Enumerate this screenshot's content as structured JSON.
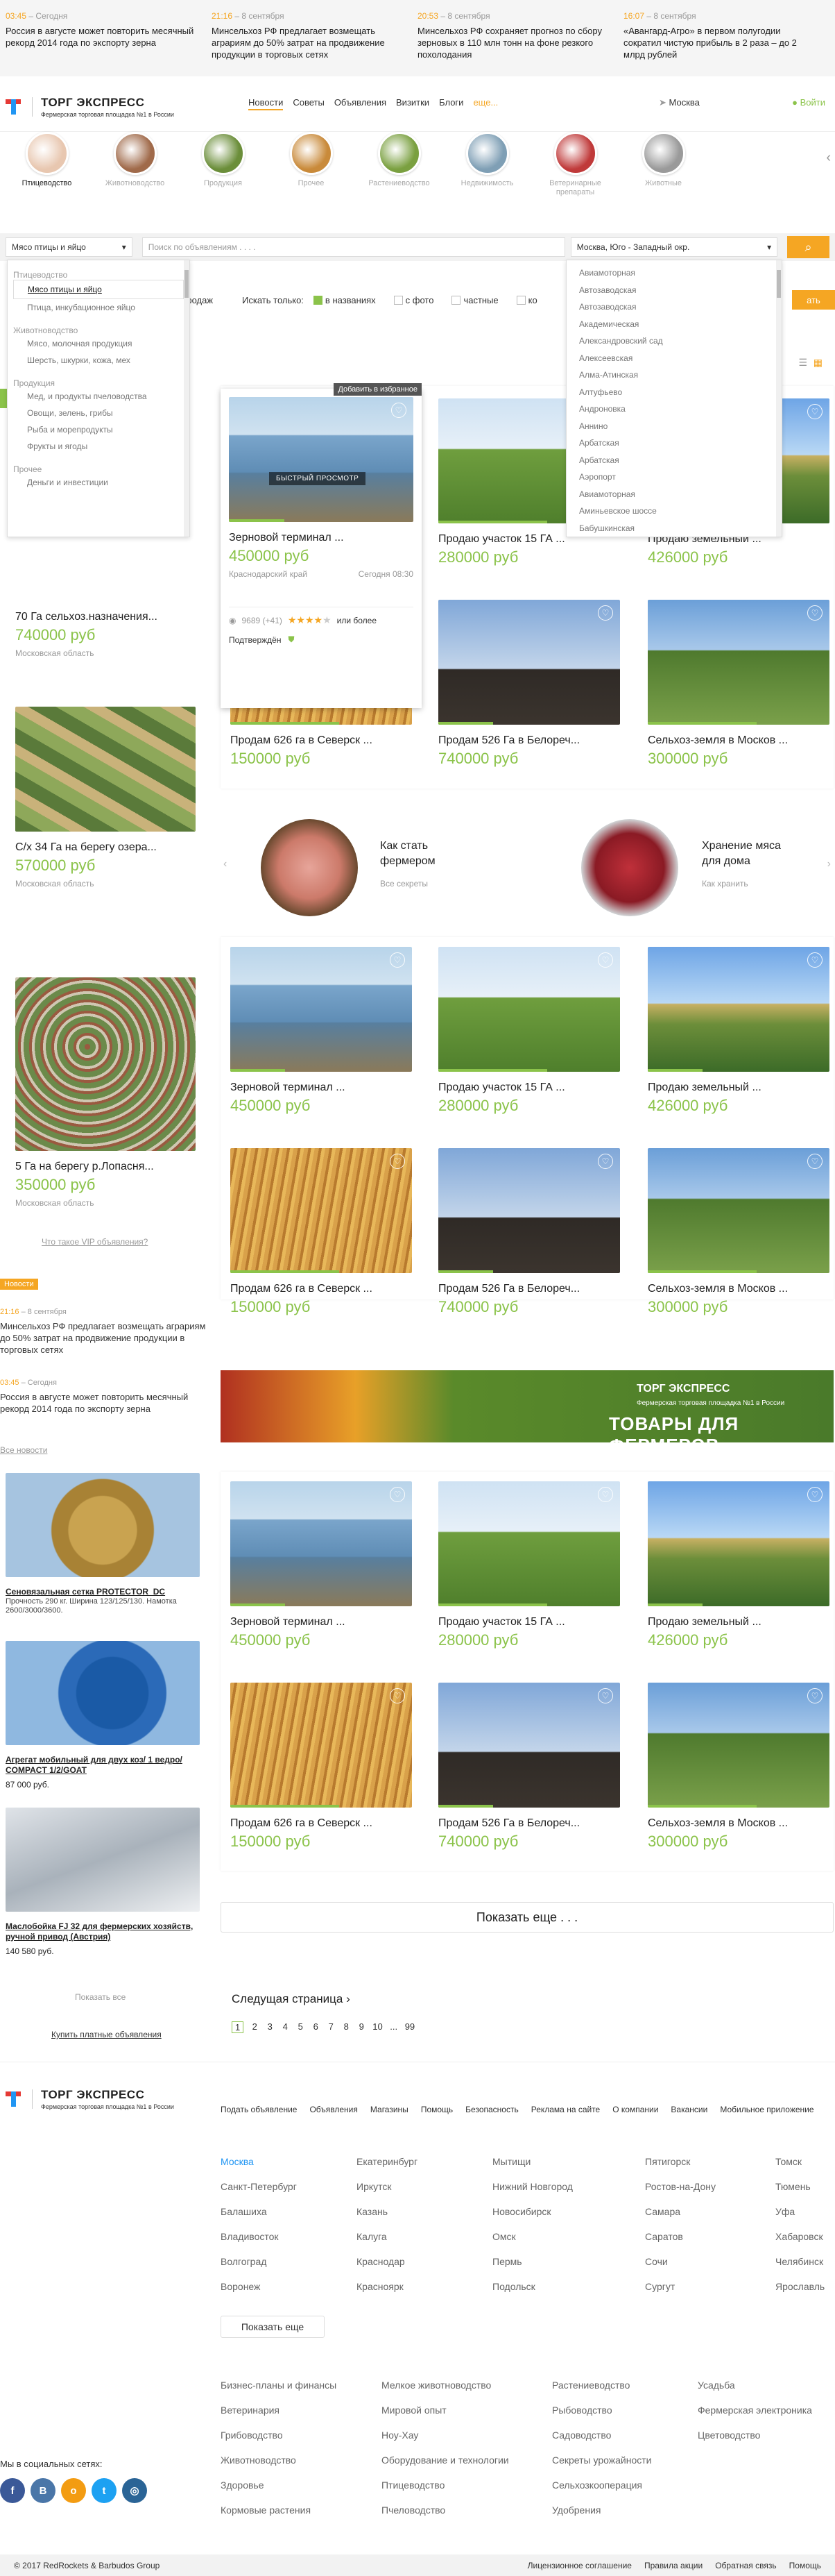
{
  "news_strip": [
    {
      "time": "03:45",
      "date": "Сегодня",
      "text": "Россия в августе может повторить ме­сячный рекорд 2014 года по экспорту зерна"
    },
    {
      "time": "21:16",
      "date": "8 сентября",
      "text": "Минсельхоз РФ предлагает возмещать аграриям до 50% затрат на продвижение продукции в торговых сетях"
    },
    {
      "time": "20:53",
      "date": "8 сентября",
      "text": "Минсельхоз РФ сохраняет прогноз по сбору зерновых в 110 млн тонн на фоне резкого похолодания"
    },
    {
      "time": "16:07",
      "date": "8 сентября",
      "text": "«Авангард-Агро» в первом полугодии сократил чистую прибыль в 2 раза – до 2 млрд рублей"
    }
  ],
  "header": {
    "logo_title": "ТОРГ ЭКСПРЕСС",
    "logo_sub": "Фермерская торговая площадка №1 в России",
    "nav": [
      "Новости",
      "Советы",
      "Объявления",
      "Визитки",
      "Блоги"
    ],
    "nav_more": "еще...",
    "city": "Москва",
    "login": "Войти"
  },
  "categories": [
    {
      "label": "Птицеводство",
      "color": "#e8c7b0"
    },
    {
      "label": "Животновод­ство",
      "color": "#a06a4a"
    },
    {
      "label": "Продукция",
      "color": "#6b8e3a"
    },
    {
      "label": "Прочее",
      "color": "#c98a3a"
    },
    {
      "label": "Растениевод­ство",
      "color": "#7aa040"
    },
    {
      "label": "Недвижимость",
      "color": "#7f9fb5"
    },
    {
      "label": "Ветеринарные препараты",
      "color": "#c03a3a"
    },
    {
      "label": "Животные",
      "color": "#9a9a9a"
    }
  ],
  "search": {
    "category": "Мясо птицы и яйцо",
    "placeholder": "Поиск по объявлениям . . . .",
    "region": "Москва, Юго - Западный окр."
  },
  "filter": {
    "trade_label": "Продаж",
    "only_label": "Искать только:",
    "options": [
      "в названиях",
      "с фото",
      "частные",
      "ко"
    ],
    "show": "ать"
  },
  "cat_dropdown": [
    {
      "group": "Птицеводство",
      "items": [
        "Мясо птицы и яйцо",
        "Птица, инкубационное яйцо"
      ]
    },
    {
      "group": "Животноводство",
      "items": [
        "Мясо, молочная продукция",
        "Шерсть, шкурки, кожа, мех"
      ]
    },
    {
      "group": "Продукция",
      "items": [
        "Мед, и продукты пчеловодства",
        "Овощи, зелень, грибы",
        "Рыба и морепродукты",
        "Фрукты и ягоды"
      ]
    },
    {
      "group": "Прочее",
      "items": [
        "Деньги и инвестиции"
      ]
    }
  ],
  "city_dropdown": [
    "Авиамоторная",
    "Автозаводская",
    "Автозаводская",
    "Академическая",
    "Александровский сад",
    "Алексеевская",
    "Алма-Атинская",
    "Алтуфьево",
    "Андроновка",
    "Аннино",
    "Арбатская",
    "Арбатская",
    "Аэропорт",
    "Авиамоторная",
    "Аминьевское шоссе",
    "Бабушкинская"
  ],
  "vip": [
    {
      "title": "70 Га сельхоз.назначения...",
      "price": "740000 руб",
      "region": "Московская область"
    },
    {
      "title": "С/х 34 Га на берегу озера...",
      "price": "570000 руб",
      "region": "Московская область"
    },
    {
      "title": "5 Га на берегу р.Лопасня...",
      "price": "350000 руб",
      "region": "Московская область"
    }
  ],
  "vip_link": "Что такое VIP объявления?",
  "featured": {
    "fav": "Добавить в избранное",
    "quick": "БЫСТРЫЙ ПРОСМОТР",
    "title": "Зерновой терминал ...",
    "price": "450000 руб",
    "region": "Краснодарский край",
    "time": "Сегодня 08:30",
    "views": "9689 (+41)",
    "rating": "или более",
    "status": "Подтверждён"
  },
  "grid": [
    {
      "title": "Зерновой терминал ...",
      "price": "450000 руб",
      "type": "img-grain"
    },
    {
      "title": "Продаю участок 15 ГА ...",
      "price": "280000 руб",
      "type": "img-field"
    },
    {
      "title": "Продаю земельный ...",
      "price": "426000 руб",
      "type": "img-land"
    },
    {
      "title": "Продам 626 га в Северск ...",
      "price": "150000 руб",
      "type": "img-wheat"
    },
    {
      "title": "Продам 526 Га в Белореч...",
      "price": "740000 руб",
      "type": "img-dark"
    },
    {
      "title": "Сельхоз-земля в Москов ...",
      "price": "300000 руб",
      "type": "img-green"
    }
  ],
  "promo": [
    {
      "title": "Как стать фермером",
      "sub": "Все секреты"
    },
    {
      "title": "Хранение мяса для дома",
      "sub": "Как хранить"
    }
  ],
  "news_side": {
    "badge": "Новости",
    "items": [
      {
        "time": "21:16",
        "date": "8 сентября",
        "text": "Минсельхоз РФ предлагает возмещать аграриям до 50% затрат на продвиже­ние продукции в торговых сетях"
      },
      {
        "time": "03:45",
        "date": "Сегодня",
        "text": "Россия в августе может повторить месячный рекорд 2014 года по экспорту зерна"
      }
    ],
    "all": "Все новости"
  },
  "banner": {
    "title": "ТОРГ ЭКСПРЕСС",
    "sub": "Фермерская торговая площадка №1 в России",
    "slogan": "ТОВАРЫ ДЛЯ ФЕРМЕРОВ"
  },
  "ads": [
    {
      "title": "Сеновязальная сетка PROTECTOR_DC",
      "text": "Прочность 290 кг. Ширина 123/125/130. Намотка 2600/3000/3600.",
      "price": ""
    },
    {
      "title": "Агрегат мобильный для двух коз/ 1 ведро/ COMPACT 1/2/GOAT",
      "text": "",
      "price": "87 000 руб."
    },
    {
      "title": "Маслобойка FJ 32 для фермерских хозяйств, ручной привод (Австрия)",
      "text": "",
      "price": "140 580 руб."
    }
  ],
  "ads_all": "Показать все",
  "ads_buy": "Купить платные объявления",
  "more": "Показать еще . . .",
  "next_page": "Следущая страница",
  "pages": [
    "1",
    "2",
    "3",
    "4",
    "5",
    "6",
    "7",
    "8",
    "9",
    "10",
    "...",
    "99"
  ],
  "footer": {
    "nav": [
      "Подать объявление",
      "Объявления",
      "Магазины",
      "Помощь",
      "Безопасность",
      "Реклама на сайте",
      "О компании",
      "Вакансии",
      "Мобильное приложение"
    ],
    "cities": [
      [
        "Москва",
        "Санкт-Петербург",
        "Балашиха",
        "Владивосток",
        "Волгоград",
        "Воронеж"
      ],
      [
        "Екатеринбург",
        "Иркутск",
        "Казань",
        "Калуга",
        "Краснодар",
        "Красноярк"
      ],
      [
        "Мытищи",
        "Нижний Новгород",
        "Новосибирск",
        "Омск",
        "Пермь",
        "Подольск"
      ],
      [
        "Пятигорск",
        "Ростов-на-Дону",
        "Самара",
        "Саратов",
        "Сочи",
        "Сургут"
      ],
      [
        "Томск",
        "Тюмень",
        "Уфа",
        "Хабаровск",
        "Челябинск",
        "Ярославль"
      ]
    ],
    "show_more": "Показать еще",
    "topics": [
      [
        "Бизнес-планы и финансы",
        "Ветеринария",
        "Грибоводство",
        "Животноводство",
        "Здоровье",
        "Кормовые растения"
      ],
      [
        "Мелкое животноводство",
        "Мировой опыт",
        "Ноу-Хау",
        "Оборудование и технологии",
        "Птицеводство",
        "Пчеловодство"
      ],
      [
        "Растениеводство",
        "Рыбоводство",
        "Садоводство",
        "Секреты урожайности",
        "Сельхозкооперация",
        "Удобрения"
      ],
      [
        "Усадьба",
        "Фермерская электроника",
        "Цветоводство"
      ]
    ],
    "social_label": "Мы в социальных сетях:",
    "social": [
      {
        "icon": "facebook-icon",
        "glyph": "f",
        "color": "#3b5998"
      },
      {
        "icon": "vk-icon",
        "glyph": "В",
        "color": "#4a76a8"
      },
      {
        "icon": "odnoklassniki-icon",
        "glyph": "о",
        "color": "#f39c12"
      },
      {
        "icon": "twitter-icon",
        "glyph": "t",
        "color": "#1da1f2"
      },
      {
        "icon": "instagram-icon",
        "glyph": "◎",
        "color": "#2a6496"
      }
    ],
    "copyright": "© 2017 RedRockets & Barbudos Group",
    "links": [
      "Лицензионное соглашение",
      "Правила акции",
      "Обратная связь",
      "Помощь"
    ]
  }
}
